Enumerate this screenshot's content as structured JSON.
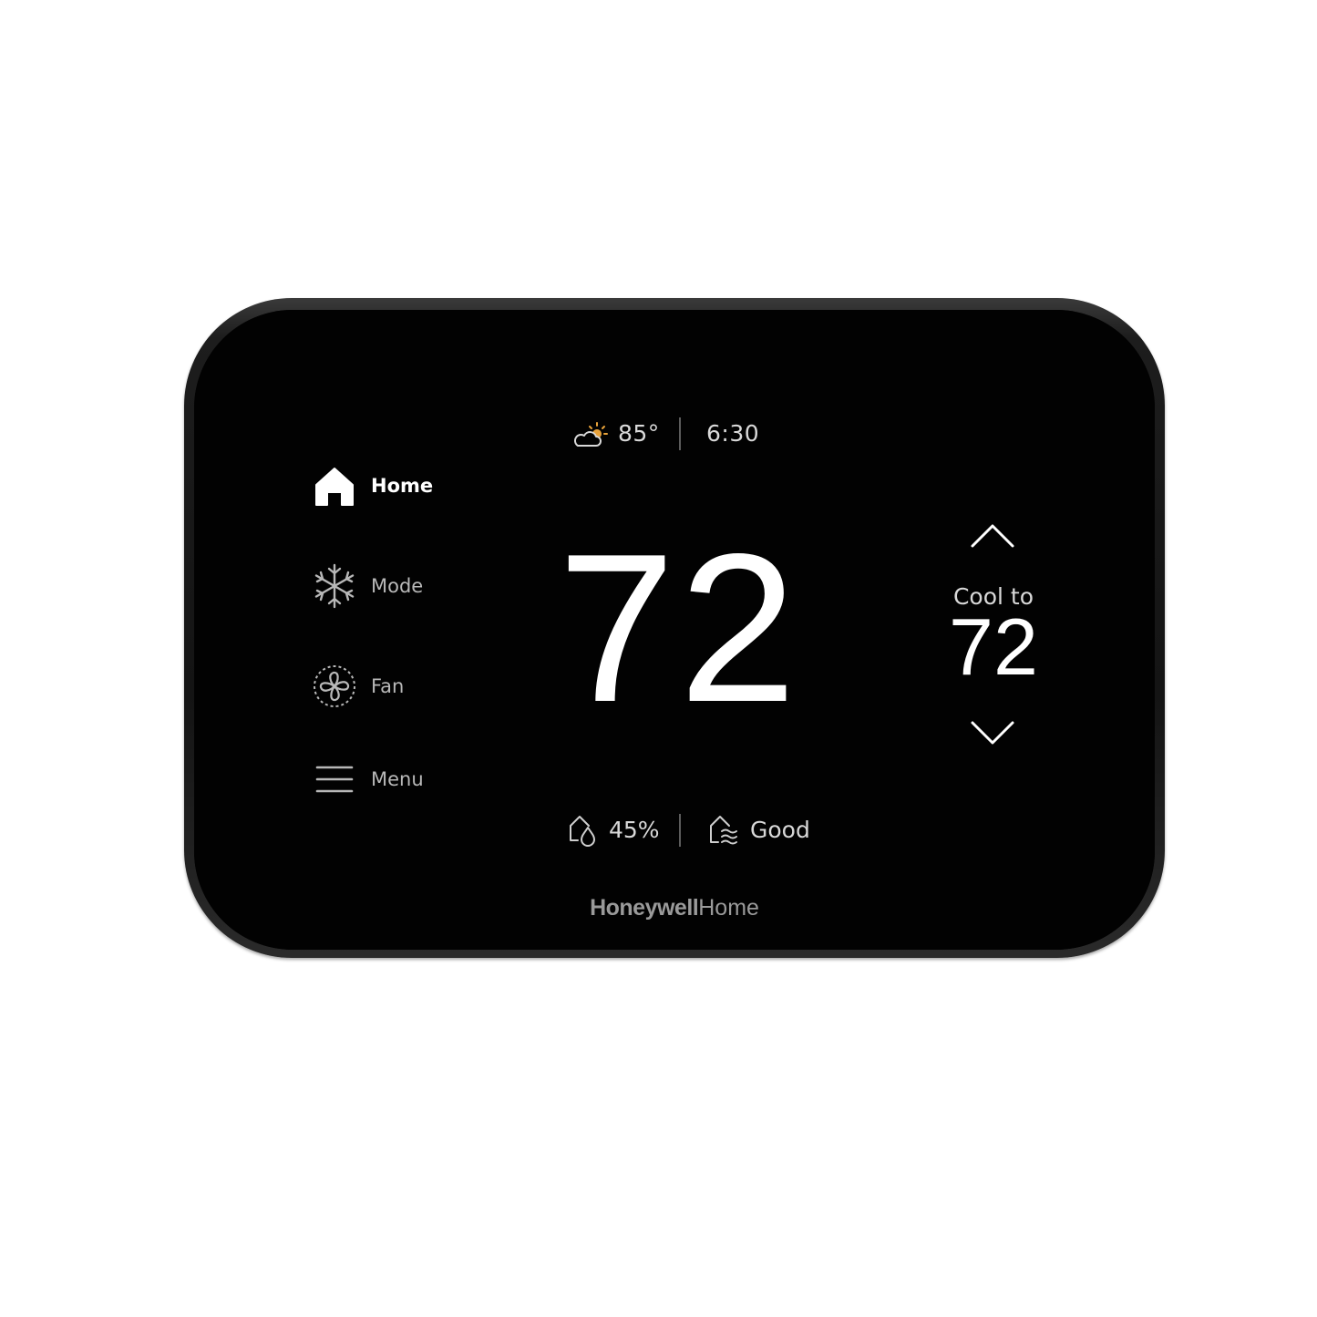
{
  "status_bar": {
    "weather_icon": "partly-sunny-icon",
    "outdoor_temp": "85°",
    "time": "6:30"
  },
  "nav": {
    "items": [
      {
        "label": "Home",
        "icon": "home-icon",
        "active": true
      },
      {
        "label": "Mode",
        "icon": "snowflake-icon",
        "active": false
      },
      {
        "label": "Fan",
        "icon": "fan-icon",
        "active": false
      },
      {
        "label": "Menu",
        "icon": "menu-icon",
        "active": false
      }
    ]
  },
  "thermostat": {
    "current_temp": "72",
    "setpoint_label": "Cool to",
    "setpoint_value": "72"
  },
  "bottom_bar": {
    "humidity_icon": "humidity-icon",
    "humidity": "45%",
    "air_quality_icon": "air-quality-icon",
    "air_quality": "Good"
  },
  "brand": {
    "name_bold": "Honeywell",
    "name_regular": "Home"
  },
  "colors": {
    "screen": "#020202",
    "primary_text": "#ffffff",
    "secondary_text": "#d9d9d9",
    "sun": "#e8a23a"
  }
}
